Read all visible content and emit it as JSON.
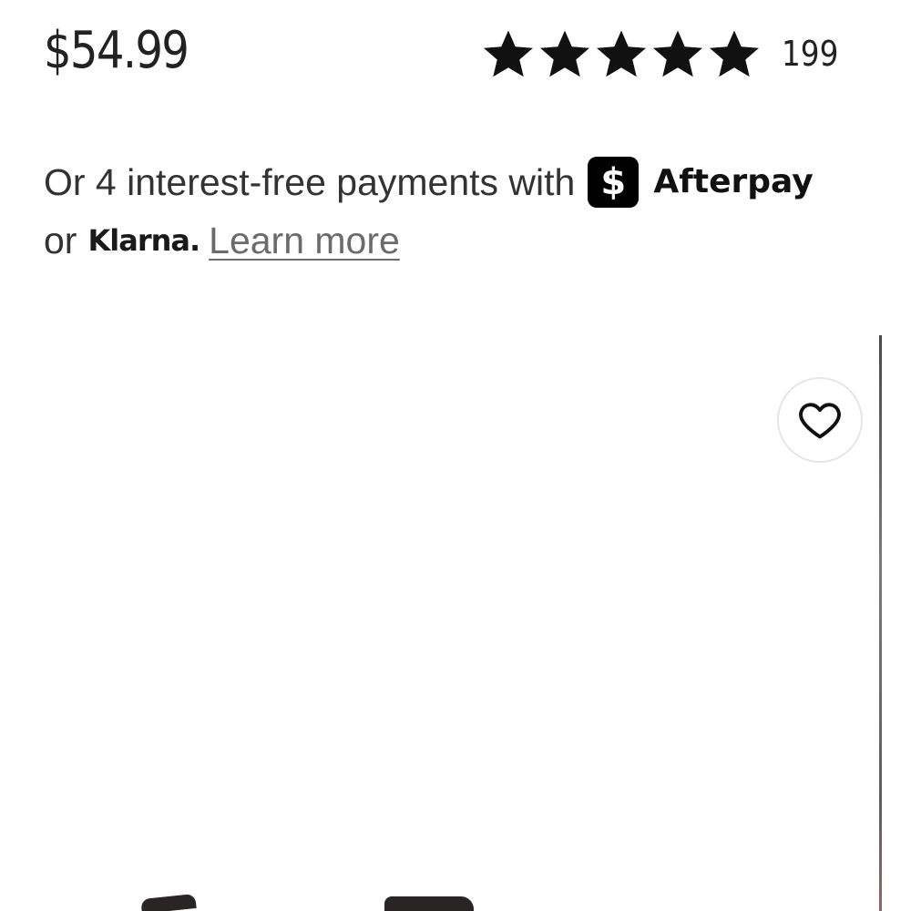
{
  "product": {
    "price": "$54.99",
    "rating": {
      "stars_filled": 5,
      "stars_total": 5,
      "review_count": "199"
    }
  },
  "payments": {
    "line1_text": "Or 4 interest-free payments with",
    "afterpay_badge": "$",
    "afterpay_name": "Afterpay",
    "or_text": "or",
    "klarna_name": "Klarna.",
    "learn_more": "Learn more"
  },
  "icons": {
    "star": "star-icon",
    "wishlist": "heart-icon"
  },
  "colors": {
    "text": "#222222",
    "link": "#6b6b6b",
    "afterpay_badge_bg": "#000000"
  }
}
